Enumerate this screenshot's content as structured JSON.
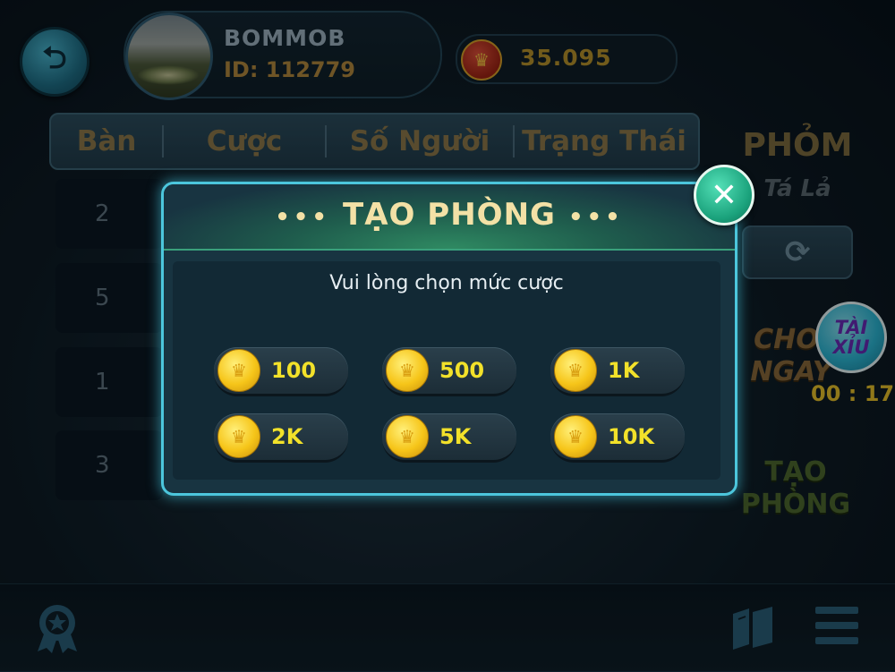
{
  "header": {
    "back_icon": "back-arrow-icon",
    "username": "BOMMOB",
    "user_id": "ID: 112779",
    "balance": "35.095",
    "balance_icon": "crown-coin-icon"
  },
  "table": {
    "headers": [
      "Bàn",
      "Cược",
      "Số Người",
      "Trạng Thái"
    ],
    "rows": [
      {
        "table_no": "2"
      },
      {
        "table_no": "5"
      },
      {
        "table_no": "1"
      },
      {
        "table_no": "3"
      }
    ]
  },
  "right_panel": {
    "game_title": "PHỎM",
    "game_subtitle": "Tá Lả",
    "refresh_icon": "refresh-icon",
    "play_now": "CHƠI NGAY",
    "create_room": "TẠO PHÒNG",
    "taixiu_label": "TÀI XỈU",
    "timer": "00 : 17"
  },
  "bottom_bar": {
    "left_icon": "medal-icon",
    "right_icons": [
      "book-icon",
      "menu-icon"
    ]
  },
  "modal": {
    "title": "TẠO PHÒNG",
    "prompt": "Vui lòng chọn mức cược",
    "bets": [
      "100",
      "500",
      "1K",
      "2K",
      "5K",
      "10K"
    ],
    "close_icon": "close-icon"
  },
  "colors": {
    "modal_border": "#4cc6dc",
    "bet_text": "#f2e12a",
    "title_text": "#f3e1a6",
    "timer": "#e9c22a"
  }
}
